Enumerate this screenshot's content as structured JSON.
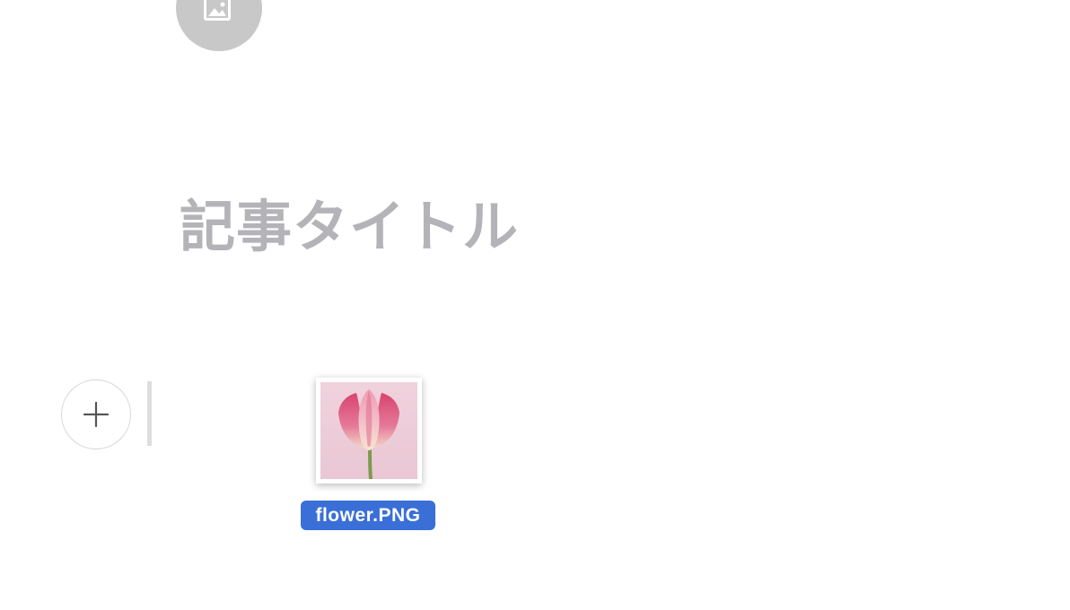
{
  "editor": {
    "title_placeholder": "記事タイトル",
    "cover_image_icon": "image-icon",
    "add_block_icon": "plus-icon"
  },
  "drag": {
    "file_name": "flower.PNG",
    "thumbnail_icon": "tulip-photo"
  },
  "colors": {
    "title_placeholder": "#b3b3b8",
    "upload_circle": "#c8c8c8",
    "file_label_bg": "#3a6fd8",
    "caret": "#dedede"
  }
}
